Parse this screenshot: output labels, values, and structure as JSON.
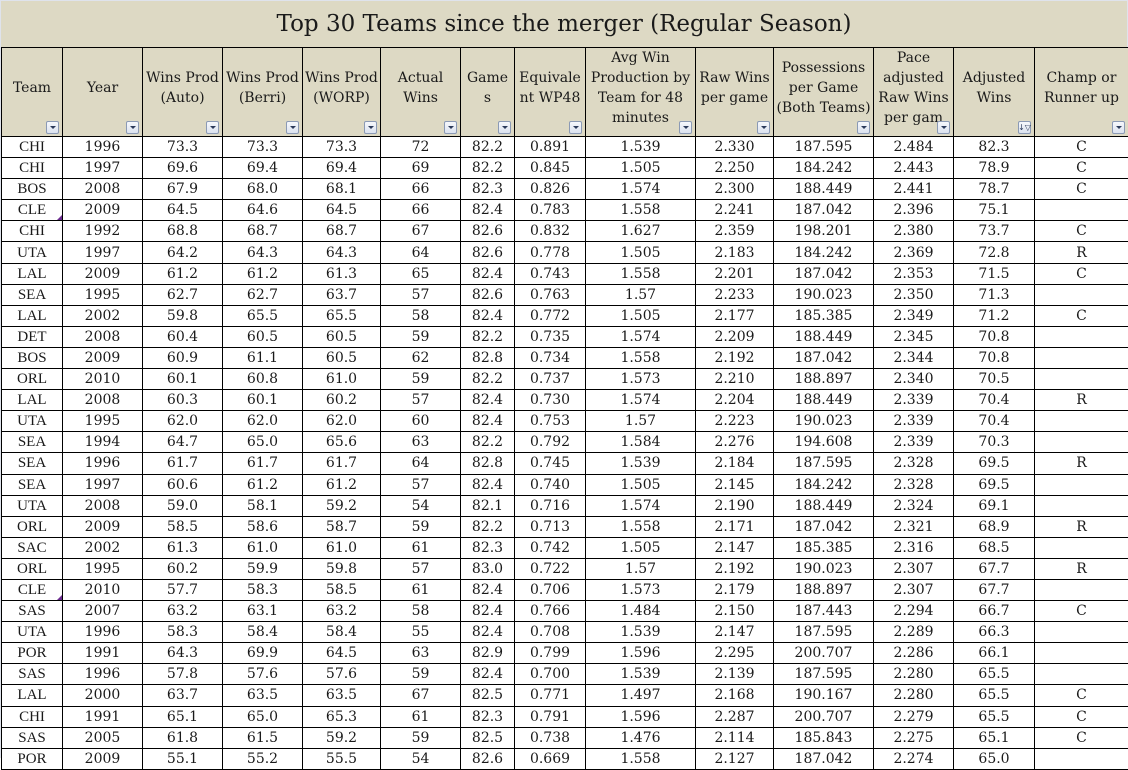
{
  "title": "Top 30 Teams since the merger (Regular Season)",
  "columns": [
    {
      "key": "team",
      "label": "Team",
      "filter": "dropdown"
    },
    {
      "key": "year",
      "label": "Year",
      "filter": "dropdown"
    },
    {
      "key": "wp_auto",
      "label": "Wins Prod (Auto)",
      "filter": "dropdown"
    },
    {
      "key": "wp_berri",
      "label": "Wins Prod (Berri)",
      "filter": "dropdown"
    },
    {
      "key": "wp_worp",
      "label": "Wins Prod (WORP)",
      "filter": "dropdown"
    },
    {
      "key": "actual_wins",
      "label": "Actual Wins",
      "filter": "dropdown"
    },
    {
      "key": "games",
      "label": "Game s",
      "filter": "dropdown"
    },
    {
      "key": "equiv_wp48",
      "label": "Equivale nt WP48",
      "filter": "dropdown"
    },
    {
      "key": "avg_win_prod",
      "label": "Avg Win Production by Team for 48 minutes",
      "filter": "dropdown"
    },
    {
      "key": "raw_wins",
      "label": "Raw Wins per game",
      "filter": "dropdown"
    },
    {
      "key": "possessions",
      "label": "Possessions per Game (Both Teams)",
      "filter": "dropdown"
    },
    {
      "key": "pace_adj",
      "label": "Pace adjusted Raw Wins per gam",
      "filter": "dropdown"
    },
    {
      "key": "adj_wins",
      "label": "Adjusted Wins",
      "filter": "sort-filter-active"
    },
    {
      "key": "champ",
      "label": "Champ or Runner up",
      "filter": "dropdown"
    }
  ],
  "rows": [
    [
      "CHI",
      "1996",
      "73.3",
      "73.3",
      "73.3",
      "72",
      "82.2",
      "0.891",
      "1.539",
      "2.330",
      "187.595",
      "2.484",
      "82.3",
      "C"
    ],
    [
      "CHI",
      "1997",
      "69.6",
      "69.4",
      "69.4",
      "69",
      "82.2",
      "0.845",
      "1.505",
      "2.250",
      "184.242",
      "2.443",
      "78.9",
      "C"
    ],
    [
      "BOS",
      "2008",
      "67.9",
      "68.0",
      "68.1",
      "66",
      "82.3",
      "0.826",
      "1.574",
      "2.300",
      "188.449",
      "2.441",
      "78.7",
      "C"
    ],
    [
      "CLE",
      "2009",
      "64.5",
      "64.6",
      "64.5",
      "66",
      "82.4",
      "0.783",
      "1.558",
      "2.241",
      "187.042",
      "2.396",
      "75.1",
      ""
    ],
    [
      "CHI",
      "1992",
      "68.8",
      "68.7",
      "68.7",
      "67",
      "82.6",
      "0.832",
      "1.627",
      "2.359",
      "198.201",
      "2.380",
      "73.7",
      "C"
    ],
    [
      "UTA",
      "1997",
      "64.2",
      "64.3",
      "64.3",
      "64",
      "82.6",
      "0.778",
      "1.505",
      "2.183",
      "184.242",
      "2.369",
      "72.8",
      "R"
    ],
    [
      "LAL",
      "2009",
      "61.2",
      "61.2",
      "61.3",
      "65",
      "82.4",
      "0.743",
      "1.558",
      "2.201",
      "187.042",
      "2.353",
      "71.5",
      "C"
    ],
    [
      "SEA",
      "1995",
      "62.7",
      "62.7",
      "63.7",
      "57",
      "82.6",
      "0.763",
      "1.57",
      "2.233",
      "190.023",
      "2.350",
      "71.3",
      ""
    ],
    [
      "LAL",
      "2002",
      "59.8",
      "65.5",
      "65.5",
      "58",
      "82.4",
      "0.772",
      "1.505",
      "2.177",
      "185.385",
      "2.349",
      "71.2",
      "C"
    ],
    [
      "DET",
      "2008",
      "60.4",
      "60.5",
      "60.5",
      "59",
      "82.2",
      "0.735",
      "1.574",
      "2.209",
      "188.449",
      "2.345",
      "70.8",
      ""
    ],
    [
      "BOS",
      "2009",
      "60.9",
      "61.1",
      "60.5",
      "62",
      "82.8",
      "0.734",
      "1.558",
      "2.192",
      "187.042",
      "2.344",
      "70.8",
      ""
    ],
    [
      "ORL",
      "2010",
      "60.1",
      "60.8",
      "61.0",
      "59",
      "82.2",
      "0.737",
      "1.573",
      "2.210",
      "188.897",
      "2.340",
      "70.5",
      ""
    ],
    [
      "LAL",
      "2008",
      "60.3",
      "60.1",
      "60.2",
      "57",
      "82.4",
      "0.730",
      "1.574",
      "2.204",
      "188.449",
      "2.339",
      "70.4",
      "R"
    ],
    [
      "UTA",
      "1995",
      "62.0",
      "62.0",
      "62.0",
      "60",
      "82.4",
      "0.753",
      "1.57",
      "2.223",
      "190.023",
      "2.339",
      "70.4",
      ""
    ],
    [
      "SEA",
      "1994",
      "64.7",
      "65.0",
      "65.6",
      "63",
      "82.2",
      "0.792",
      "1.584",
      "2.276",
      "194.608",
      "2.339",
      "70.3",
      ""
    ],
    [
      "SEA",
      "1996",
      "61.7",
      "61.7",
      "61.7",
      "64",
      "82.8",
      "0.745",
      "1.539",
      "2.184",
      "187.595",
      "2.328",
      "69.5",
      "R"
    ],
    [
      "SEA",
      "1997",
      "60.6",
      "61.2",
      "61.2",
      "57",
      "82.4",
      "0.740",
      "1.505",
      "2.145",
      "184.242",
      "2.328",
      "69.5",
      ""
    ],
    [
      "UTA",
      "2008",
      "59.0",
      "58.1",
      "59.2",
      "54",
      "82.1",
      "0.716",
      "1.574",
      "2.190",
      "188.449",
      "2.324",
      "69.1",
      ""
    ],
    [
      "ORL",
      "2009",
      "58.5",
      "58.6",
      "58.7",
      "59",
      "82.2",
      "0.713",
      "1.558",
      "2.171",
      "187.042",
      "2.321",
      "68.9",
      "R"
    ],
    [
      "SAC",
      "2002",
      "61.3",
      "61.0",
      "61.0",
      "61",
      "82.3",
      "0.742",
      "1.505",
      "2.147",
      "185.385",
      "2.316",
      "68.5",
      ""
    ],
    [
      "ORL",
      "1995",
      "60.2",
      "59.9",
      "59.8",
      "57",
      "83.0",
      "0.722",
      "1.57",
      "2.192",
      "190.023",
      "2.307",
      "67.7",
      "R"
    ],
    [
      "CLE",
      "2010",
      "57.7",
      "58.3",
      "58.5",
      "61",
      "82.4",
      "0.706",
      "1.573",
      "2.179",
      "188.897",
      "2.307",
      "67.7",
      ""
    ],
    [
      "SAS",
      "2007",
      "63.2",
      "63.1",
      "63.2",
      "58",
      "82.4",
      "0.766",
      "1.484",
      "2.150",
      "187.443",
      "2.294",
      "66.7",
      "C"
    ],
    [
      "UTA",
      "1996",
      "58.3",
      "58.4",
      "58.4",
      "55",
      "82.4",
      "0.708",
      "1.539",
      "2.147",
      "187.595",
      "2.289",
      "66.3",
      ""
    ],
    [
      "POR",
      "1991",
      "64.3",
      "69.9",
      "64.5",
      "63",
      "82.9",
      "0.799",
      "1.596",
      "2.295",
      "200.707",
      "2.286",
      "66.1",
      ""
    ],
    [
      "SAS",
      "1996",
      "57.8",
      "57.6",
      "57.6",
      "59",
      "82.4",
      "0.700",
      "1.539",
      "2.139",
      "187.595",
      "2.280",
      "65.5",
      ""
    ],
    [
      "LAL",
      "2000",
      "63.7",
      "63.5",
      "63.5",
      "67",
      "82.5",
      "0.771",
      "1.497",
      "2.168",
      "190.167",
      "2.280",
      "65.5",
      "C"
    ],
    [
      "CHI",
      "1991",
      "65.1",
      "65.0",
      "65.3",
      "61",
      "82.3",
      "0.791",
      "1.596",
      "2.287",
      "200.707",
      "2.279",
      "65.5",
      "C"
    ],
    [
      "SAS",
      "2005",
      "61.8",
      "61.5",
      "59.2",
      "59",
      "82.5",
      "0.738",
      "1.476",
      "2.114",
      "185.843",
      "2.275",
      "65.1",
      "C"
    ],
    [
      "POR",
      "2009",
      "55.1",
      "55.2",
      "55.5",
      "54",
      "82.6",
      "0.669",
      "1.558",
      "2.127",
      "187.042",
      "2.274",
      "65.0",
      ""
    ]
  ],
  "comment_cells": [
    [
      3,
      0
    ],
    [
      21,
      0
    ]
  ],
  "colors": {
    "header_bg": "#ddd9c4",
    "grid": "#000000",
    "comment_marker": "#6b2c8f"
  }
}
